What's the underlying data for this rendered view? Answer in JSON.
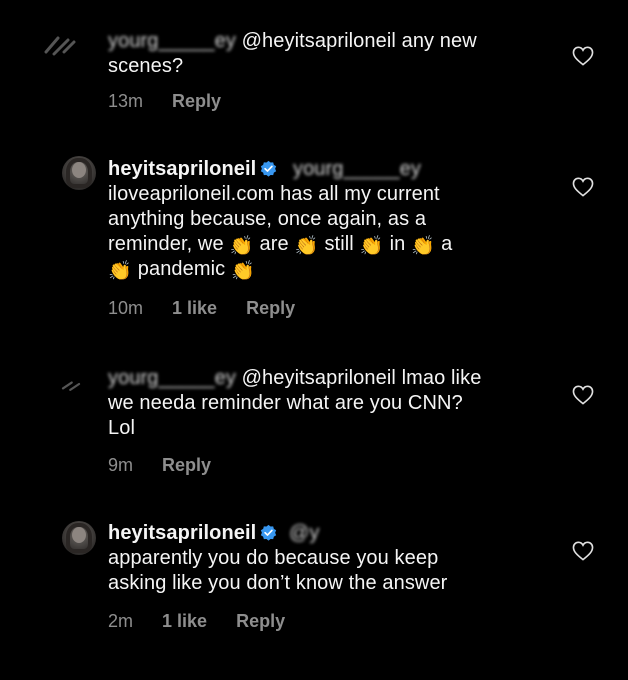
{
  "colors": {
    "background": "#000000",
    "text": "#f5f5f5",
    "meta": "#8e8e8e",
    "verified": "#3897f0"
  },
  "comments": [
    {
      "user_blurred": "yourg_____ey",
      "mention": "@heyitsapriloneil any new",
      "line2": "scenes?",
      "time": "13m",
      "reply_label": "Reply",
      "like_icon": "heart-icon"
    },
    {
      "username": "heyitsapriloneil",
      "verified_icon": "verified-badge-icon",
      "user_blurred": "yourg_____ey",
      "line1": "iloveapriloneil.com has all my current",
      "line2": "anything because, once again, as a",
      "line3_words": [
        "reminder, we",
        "are",
        "still",
        "in",
        "a"
      ],
      "line4_words": [
        "pandemic"
      ],
      "clap_icon": "👏",
      "time": "10m",
      "likes": "1 like",
      "reply_label": "Reply",
      "like_icon": "heart-icon"
    },
    {
      "user_blurred": "yourg_____ey",
      "mention": "@heyitsapriloneil lmao like",
      "line2": "we needa reminder what are you CNN?",
      "line3": "Lol",
      "time": "9m",
      "reply_label": "Reply",
      "like_icon": "heart-icon"
    },
    {
      "username": "heyitsapriloneil",
      "verified_icon": "verified-badge-icon",
      "user_blurred": "@y",
      "line1": "apparently you do because you keep",
      "line2": "asking like you don’t know the answer",
      "time": "2m",
      "likes": "1 like",
      "reply_label": "Reply",
      "like_icon": "heart-icon"
    }
  ]
}
